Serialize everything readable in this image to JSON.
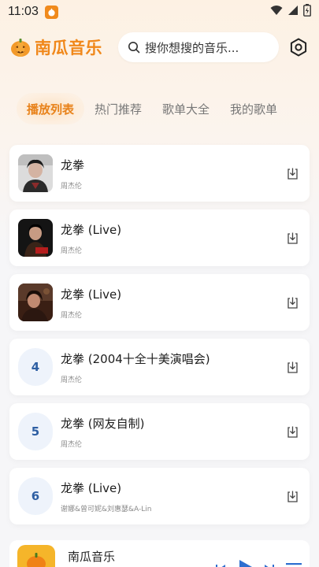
{
  "status": {
    "time": "11:03"
  },
  "header": {
    "app_title": "南瓜音乐",
    "search_placeholder": "搜你想搜的音乐..."
  },
  "tabs": [
    {
      "label": "播放列表",
      "active": true
    },
    {
      "label": "热门推荐",
      "active": false
    },
    {
      "label": "歌单大全",
      "active": false
    },
    {
      "label": "我的歌单",
      "active": false
    }
  ],
  "songs": [
    {
      "title": "龙拳",
      "artist": "周杰伦",
      "cover": "photo"
    },
    {
      "title": "龙拳 (Live)",
      "artist": "周杰伦",
      "cover": "photo"
    },
    {
      "title": "龙拳 (Live)",
      "artist": "周杰伦",
      "cover": "photo"
    },
    {
      "title": "龙拳 (2004十全十美演唱会)",
      "artist": "周杰伦",
      "number": "4"
    },
    {
      "title": "龙拳 (网友自制)",
      "artist": "周杰伦",
      "number": "5"
    },
    {
      "title": "龙拳 (Live)",
      "artist": "谢娜&曾可妮&刘惠瑟&A-Lin",
      "number": "6"
    }
  ],
  "player": {
    "title": "南瓜音乐"
  },
  "colors": {
    "accent": "#f0881b",
    "number": "#2e5fa3"
  },
  "icons": [
    "pumpkin-logo-icon",
    "search-icon",
    "settings-icon",
    "download-icon",
    "prev-icon",
    "play-icon",
    "next-icon",
    "playlist-icon"
  ]
}
